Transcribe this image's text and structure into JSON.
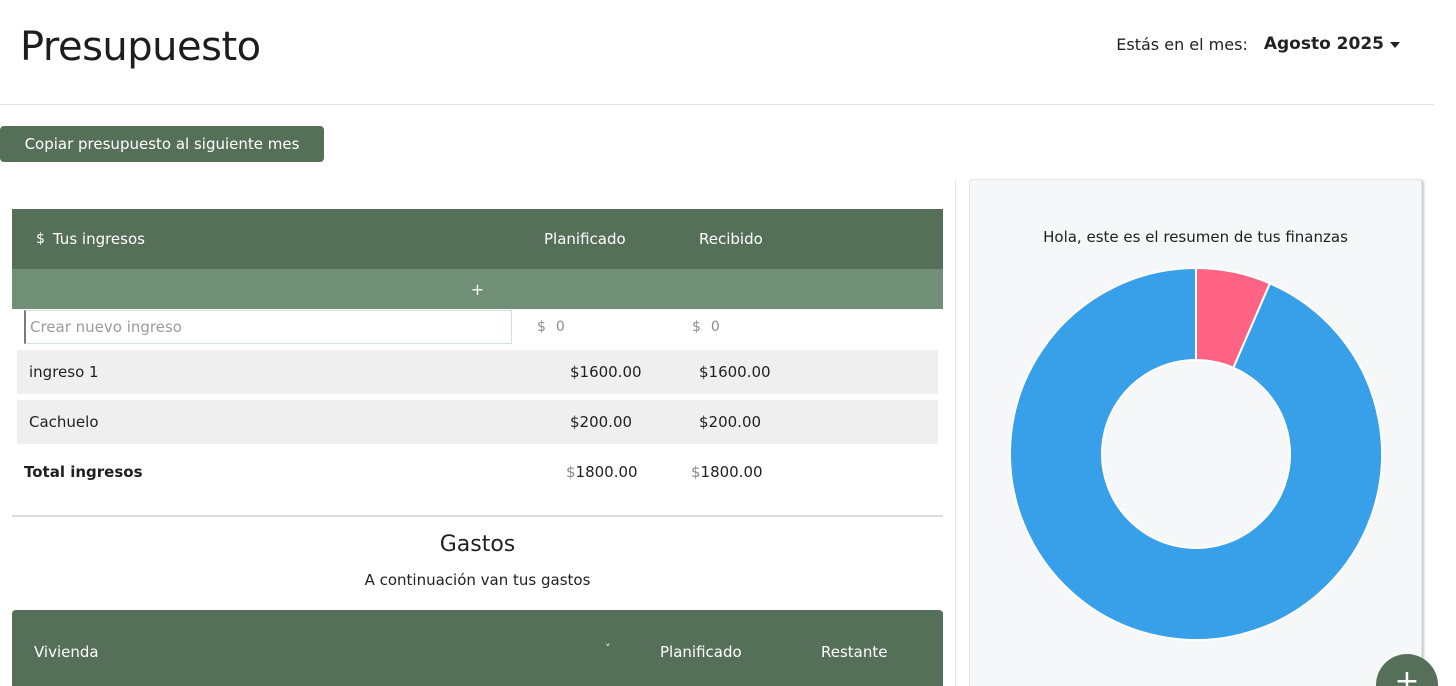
{
  "header": {
    "title": "Presupuesto",
    "month_label": "Estás en el mes:",
    "month_value": "Agosto 2025"
  },
  "toolbar": {
    "copy_label": "Copiar presupuesto al siguiente mes"
  },
  "income": {
    "header_icon": "$",
    "header_title": "Tus ingresos",
    "col_planned": "Planificado",
    "col_received": "Recibido",
    "add_label": "+",
    "new_placeholder": "Crear nuevo ingreso",
    "new_currency": "$",
    "new_planned_placeholder": "0",
    "new_received_placeholder": "0",
    "rows": [
      {
        "name": "ingreso 1",
        "planned": "$1600.00",
        "received": "$1600.00"
      },
      {
        "name": "Cachuelo",
        "planned": "$200.00",
        "received": "$200.00"
      }
    ],
    "total_label": "Total ingresos",
    "total_currency": "$",
    "total_planned": "1800.00",
    "total_received": "1800.00"
  },
  "expenses": {
    "title": "Gastos",
    "subtitle": "A continuación van tus gastos",
    "category": "Vivienda",
    "chevron": "˅",
    "col_planned": "Planificado",
    "col_remaining": "Restante"
  },
  "summary": {
    "title": "Hola, este es el resumen de tus finanzas"
  },
  "chart_data": {
    "type": "pie",
    "variant": "doughnut",
    "slices": [
      {
        "label": "",
        "value": 93.5,
        "color": "#38a0e8"
      },
      {
        "label": "",
        "value": 6.5,
        "color": "#ff6384"
      }
    ],
    "legend": "none"
  },
  "fab": {
    "icon": "plus-icon",
    "label": "+"
  },
  "colors": {
    "primary": "#566f59",
    "primary_light": "#718f76",
    "row_bg": "#efefef",
    "chart_blue": "#38a0e8",
    "chart_pink": "#ff6384"
  }
}
